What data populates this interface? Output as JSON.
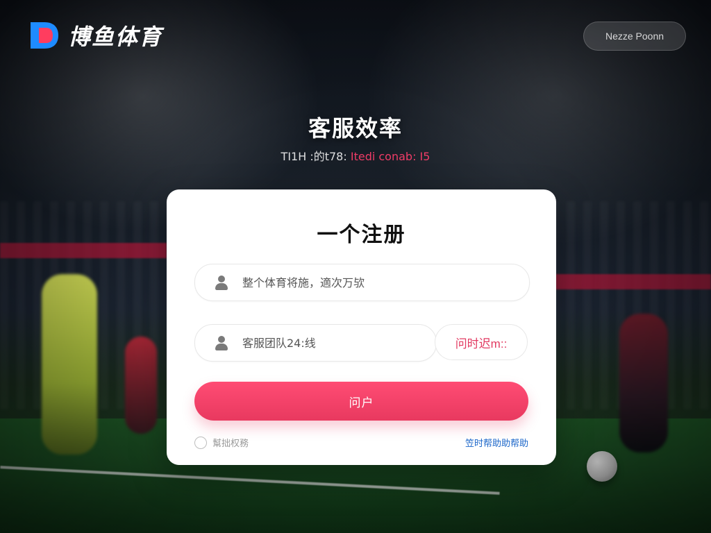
{
  "brand": {
    "name": "博鱼体育"
  },
  "top_button": {
    "label": "Nezze Poonn"
  },
  "hero": {
    "title": "客服效率",
    "subtitle_part1": "TI1H :的t78:",
    "subtitle_part2": "Itedi conab: I5"
  },
  "card": {
    "title": "一个注册",
    "field1": {
      "placeholder": "整个体育将施，適次万欤",
      "icon": "user-icon"
    },
    "field2": {
      "placeholder": "客服团队24:线",
      "icon": "user-icon"
    },
    "code_button": {
      "label": "问时迟m::"
    },
    "submit": {
      "label": "问户"
    },
    "remember": {
      "label": "幫拙权務"
    },
    "help_link": {
      "label": "笠时帮助助帮助"
    }
  },
  "colors": {
    "accent": "#e8395f",
    "link": "#1b66c9"
  }
}
